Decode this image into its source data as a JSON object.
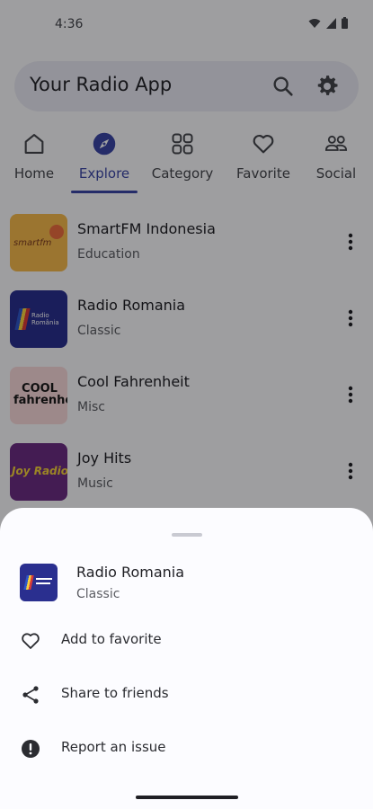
{
  "status_bar": {
    "time": "4:36"
  },
  "search": {
    "title": "Your Radio App",
    "search_icon": "search-icon",
    "settings_icon": "gear-icon"
  },
  "tabs": [
    {
      "label": "Home",
      "icon": "home-icon"
    },
    {
      "label": "Explore",
      "icon": "compass-icon",
      "active": true
    },
    {
      "label": "Category",
      "icon": "grid-icon"
    },
    {
      "label": "Favorite",
      "icon": "heart-icon"
    },
    {
      "label": "Social",
      "icon": "people-icon"
    }
  ],
  "stations": [
    {
      "name": "SmartFM Indonesia",
      "category": "Education",
      "logo_text": "smartfm"
    },
    {
      "name": "Radio Romania",
      "category": "Classic",
      "logo_text": "Radio România"
    },
    {
      "name": "Cool Fahrenheit",
      "category": "Misc",
      "logo_text": "COOL fahrenheit"
    },
    {
      "name": "Joy Hits",
      "category": "Music",
      "logo_text": "Joy Radio"
    }
  ],
  "sheet": {
    "station_name": "Radio Romania",
    "station_category": "Classic",
    "actions": [
      {
        "label": "Add to favorite",
        "icon": "heart-outline-icon"
      },
      {
        "label": "Share to friends",
        "icon": "share-icon"
      },
      {
        "label": "Report an issue",
        "icon": "alert-icon"
      }
    ]
  },
  "colors": {
    "accent": "#3b46a5",
    "background": "#f7f7fb",
    "search_bg": "#e7e7f1"
  }
}
